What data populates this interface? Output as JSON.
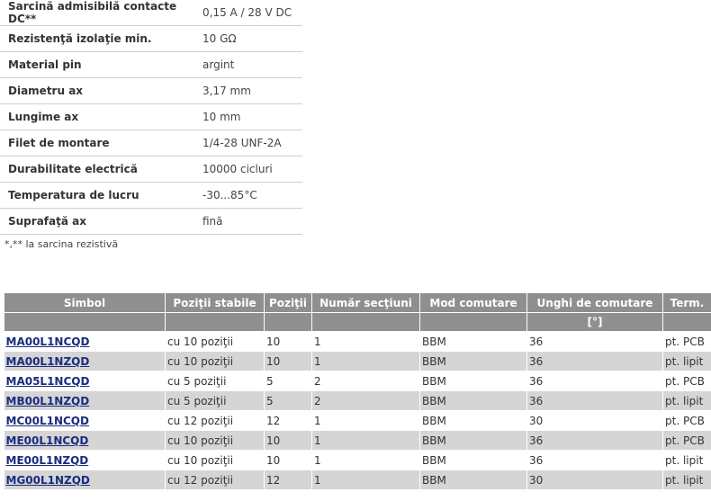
{
  "specs": [
    {
      "label": "Sarcină admisibilă contacte DC**",
      "value": "0,15 A / 28 V DC"
    },
    {
      "label": "Rezistenţă izolaţie min.",
      "value": "10 GΩ"
    },
    {
      "label": "Material pin",
      "value": "argint"
    },
    {
      "label": "Diametru ax",
      "value": "3,17 mm"
    },
    {
      "label": "Lungime ax",
      "value": "10 mm"
    },
    {
      "label": "Filet de montare",
      "value": "1/4-28 UNF-2A"
    },
    {
      "label": "Durabilitate electrică",
      "value": "10000 cicluri"
    },
    {
      "label": "Temperatura de lucru",
      "value": "-30...85°C"
    },
    {
      "label": "Suprafaţă ax",
      "value": "fină"
    }
  ],
  "note": "*,** la sarcina rezistivă",
  "products": {
    "headers": [
      "Simbol",
      "Poziţii stabile",
      "Poziţii",
      "Număr secţiuni",
      "Mod comutare",
      "Unghi de comutare",
      "Term."
    ],
    "units": [
      "",
      "",
      "",
      "",
      "",
      "[°]",
      ""
    ],
    "rows": [
      [
        "MA00L1NCQD",
        "cu 10 poziţii",
        "10",
        "1",
        "BBM",
        "36",
        "pt. PCB"
      ],
      [
        "MA00L1NZQD",
        "cu 10 poziţii",
        "10",
        "1",
        "BBM",
        "36",
        "pt. lipit"
      ],
      [
        "MA05L1NCQD",
        "cu 5 poziţii",
        "5",
        "2",
        "BBM",
        "36",
        "pt. PCB"
      ],
      [
        "MB00L1NZQD",
        "cu 5 poziţii",
        "5",
        "2",
        "BBM",
        "36",
        "pt. lipit"
      ],
      [
        "MC00L1NCQD",
        "cu 12 poziţii",
        "12",
        "1",
        "BBM",
        "30",
        "pt. PCB"
      ],
      [
        "ME00L1NCQD",
        "cu 10 poziţii",
        "10",
        "1",
        "BBM",
        "36",
        "pt. PCB"
      ],
      [
        "ME00L1NZQD",
        "cu 10 poziţii",
        "10",
        "1",
        "BBM",
        "36",
        "pt. lipit"
      ],
      [
        "MG00L1NZQD",
        "cu 12 poziţii",
        "12",
        "1",
        "BBM",
        "30",
        "pt. lipit"
      ]
    ]
  }
}
